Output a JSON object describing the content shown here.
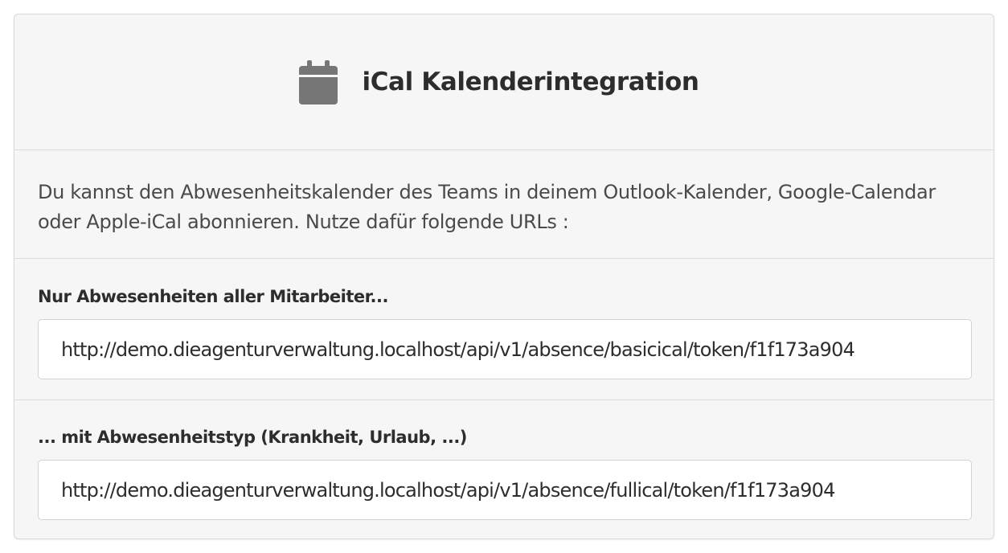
{
  "header": {
    "icon": "calendar-icon",
    "title": "iCal Kalenderintegration"
  },
  "description": "Du kannst den Abwesenheitskalender des Teams in deinem Outlook-Kalender, Google-Calendar oder Apple-iCal abonnieren. Nutze dafür folgende URLs :",
  "sections": [
    {
      "label": "Nur Abwesenheiten aller Mitarbeiter...",
      "url": "http://demo.dieagenturverwaltung.localhost/api/v1/absence/basicical/token/f1f173a904"
    },
    {
      "label": "... mit Abwesenheitstyp (Krankheit, Urlaub, ...)",
      "url": "http://demo.dieagenturverwaltung.localhost/api/v1/absence/fullical/token/f1f173a904"
    }
  ],
  "colors": {
    "icon": "#767676",
    "card_background": "#f6f6f6",
    "border": "#dcdcdc"
  }
}
